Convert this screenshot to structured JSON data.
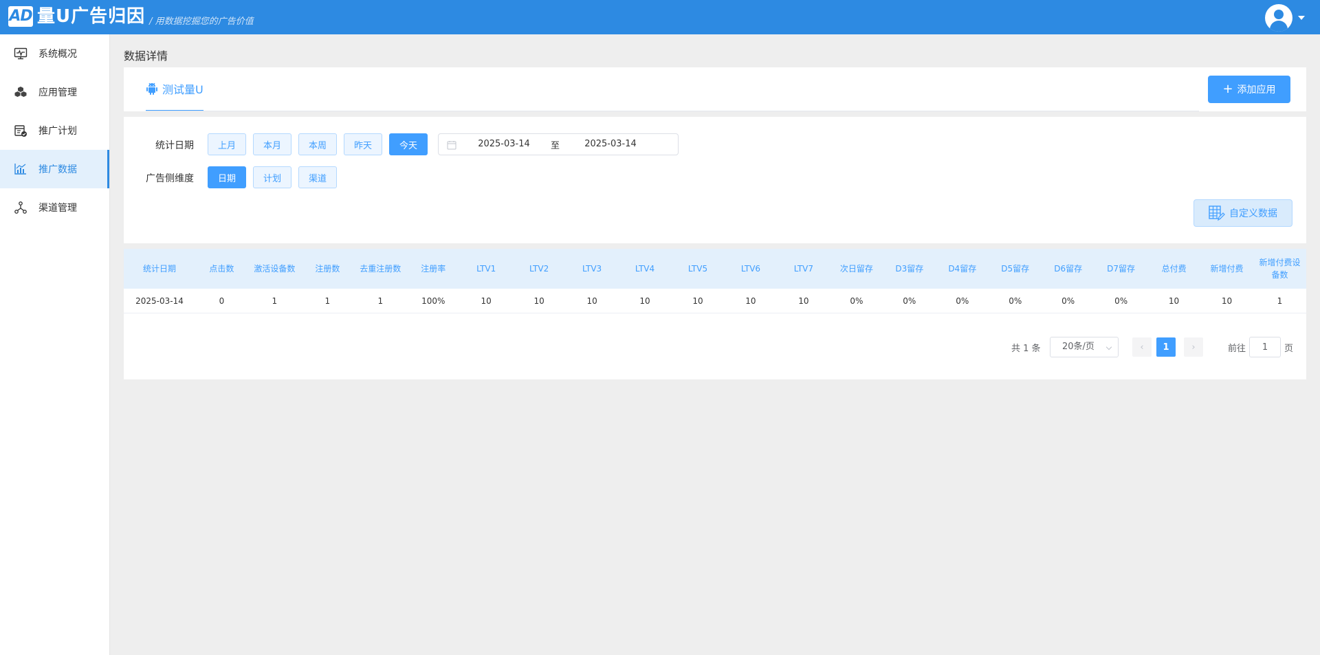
{
  "header": {
    "logo_mark": "AD",
    "app_name": "量U广告归因",
    "slogan": "/ 用数据挖掘您的广告价值"
  },
  "sidebar": {
    "items": [
      {
        "label": "系统概况",
        "icon": "monitor-icon",
        "active": false
      },
      {
        "label": "应用管理",
        "icon": "cubes-icon",
        "active": false
      },
      {
        "label": "推广计划",
        "icon": "calendar-check-icon",
        "active": false
      },
      {
        "label": "推广数据",
        "icon": "bar-chart-icon",
        "active": true
      },
      {
        "label": "渠道管理",
        "icon": "network-icon",
        "active": false
      }
    ]
  },
  "page": {
    "title": "数据详情"
  },
  "tabs": {
    "active_label": "测试量U",
    "active_icon": "android-icon",
    "add_button": "添加应用"
  },
  "filters": {
    "date_label": "统计日期",
    "date_chips": [
      {
        "label": "上月",
        "on": false
      },
      {
        "label": "本月",
        "on": false
      },
      {
        "label": "本周",
        "on": false
      },
      {
        "label": "昨天",
        "on": false
      },
      {
        "label": "今天",
        "on": true
      }
    ],
    "range_start": "2025-03-14",
    "range_sep": "至",
    "range_end": "2025-03-14",
    "dim_label": "广告侧维度",
    "dim_chips": [
      {
        "label": "日期",
        "on": true
      },
      {
        "label": "计划",
        "on": false
      },
      {
        "label": "渠道",
        "on": false
      }
    ],
    "custom_button": "自定义数据"
  },
  "table": {
    "columns": [
      "统计日期",
      "点击数",
      "激活设备数",
      "注册数",
      "去重注册数",
      "注册率",
      "LTV1",
      "LTV2",
      "LTV3",
      "LTV4",
      "LTV5",
      "LTV6",
      "LTV7",
      "次日留存",
      "D3留存",
      "D4留存",
      "D5留存",
      "D6留存",
      "D7留存",
      "总付费",
      "新增付费",
      "新增付费设备数"
    ],
    "rows": [
      [
        "2025-03-14",
        "0",
        "1",
        "1",
        "1",
        "100%",
        "10",
        "10",
        "10",
        "10",
        "10",
        "10",
        "10",
        "0%",
        "0%",
        "0%",
        "0%",
        "0%",
        "0%",
        "10",
        "10",
        "1"
      ]
    ]
  },
  "pagination": {
    "total": "共 1 条",
    "page_size": "20条/页",
    "current_page": "1",
    "goto_prefix": "前往",
    "goto_value": "1",
    "goto_suffix": "页"
  },
  "colors": {
    "header_bg": "#2d8ae2",
    "accent": "#409eff",
    "sidebar_active_bg": "#e3f0fc",
    "page_bg": "#eeeeee"
  }
}
